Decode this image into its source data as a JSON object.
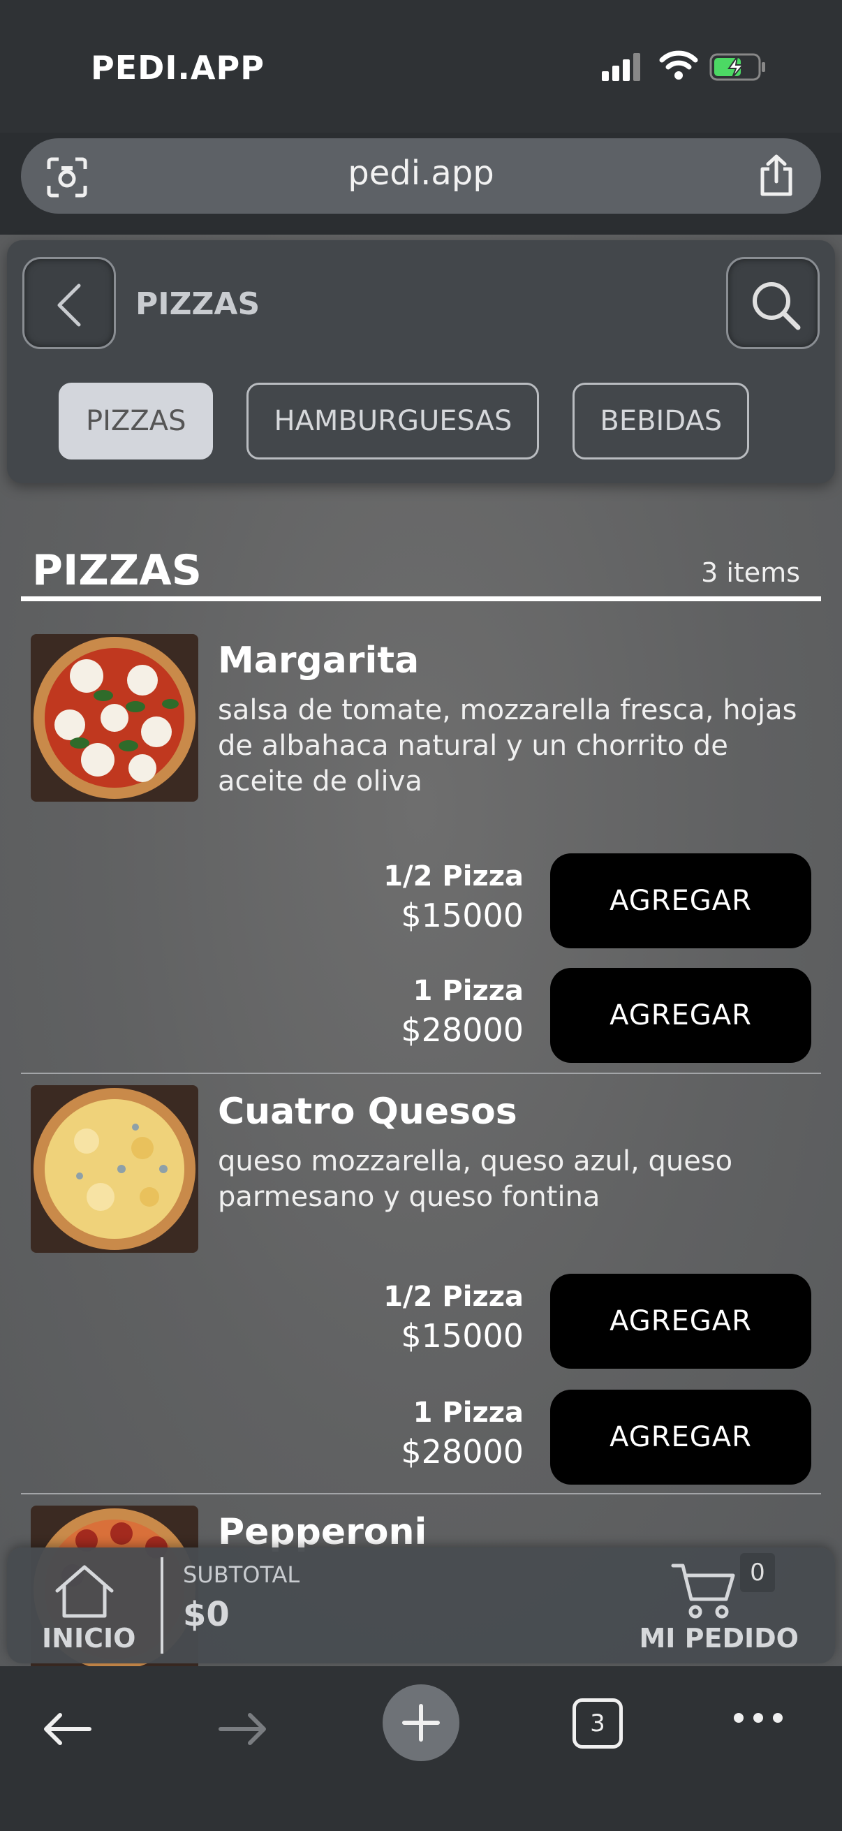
{
  "status_bar": {
    "title": "PEDI.APP"
  },
  "browser": {
    "url": "pedi.app",
    "tab_count": "3"
  },
  "header": {
    "title": "PIZZAS",
    "categories": [
      "PIZZAS",
      "HAMBURGUESAS",
      "BEBIDAS"
    ],
    "active_category": "PIZZAS"
  },
  "section": {
    "title": "PIZZAS",
    "count": "3 items"
  },
  "items": [
    {
      "name": "Margarita",
      "description": "salsa de tomate, mozzarella fresca, hojas de albahaca natural y un chorrito de aceite de oliva",
      "options": [
        {
          "label": "1/2 Pizza",
          "price": "$15000",
          "button": "AGREGAR"
        },
        {
          "label": "1 Pizza",
          "price": "$28000",
          "button": "AGREGAR"
        }
      ]
    },
    {
      "name": "Cuatro Quesos",
      "description": "queso mozzarella, queso azul, queso parmesano y queso fontina",
      "options": [
        {
          "label": "1/2 Pizza",
          "price": "$15000",
          "button": "AGREGAR"
        },
        {
          "label": "1 Pizza",
          "price": "$28000",
          "button": "AGREGAR"
        }
      ]
    },
    {
      "name": "Pepperoni"
    }
  ],
  "bottom_bar": {
    "home_label": "INICIO",
    "subtotal_label": "SUBTOTAL",
    "subtotal_value": "$0",
    "cart_count": "0",
    "cart_label": "MI PEDIDO"
  },
  "colors": {
    "button_bg": "#000000",
    "active_pill": "#d3d6dc",
    "panel": "#43474b"
  },
  "icons": [
    "back-chevron-icon",
    "search-icon",
    "home-icon",
    "cart-icon",
    "share-icon",
    "camera-scan-icon"
  ]
}
